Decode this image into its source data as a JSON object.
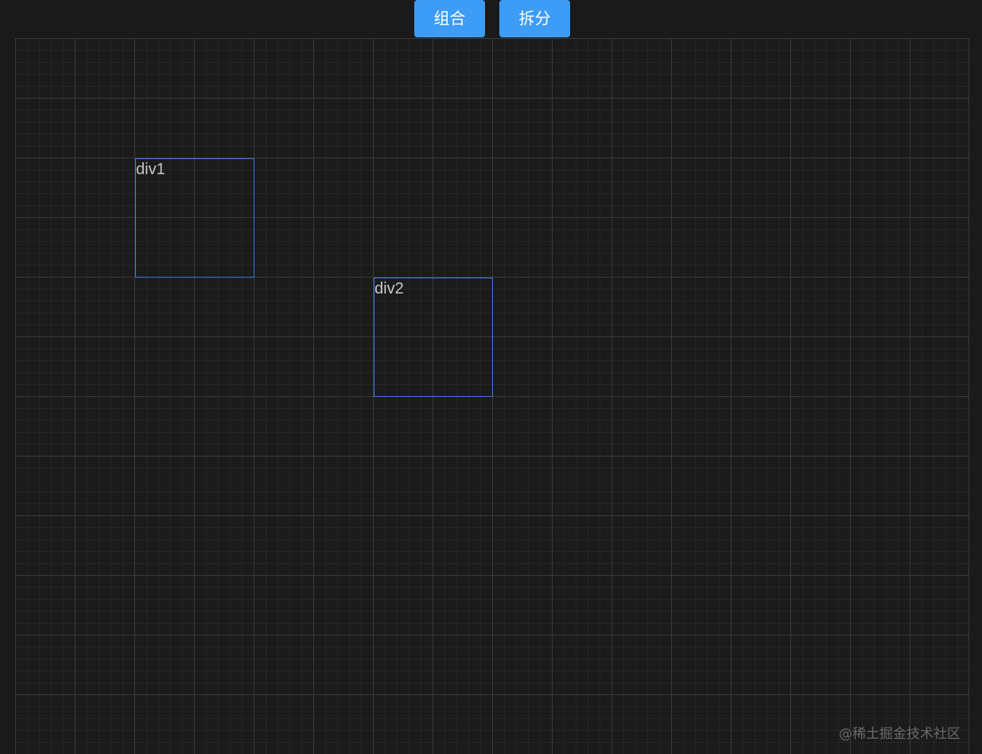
{
  "toolbar": {
    "group_label": "组合",
    "split_label": "拆分",
    "button_color": "#3d9cf5"
  },
  "canvas": {
    "background": "#1b1b1b",
    "grid_major_color": "#3a3a3a",
    "grid_minor_color": "#262626",
    "items": [
      {
        "label": "div1",
        "border_color": "#3e7be0"
      },
      {
        "label": "div2",
        "border_color": "#3e7be0"
      }
    ]
  },
  "watermark": {
    "text": "@稀土掘金技术社区"
  }
}
